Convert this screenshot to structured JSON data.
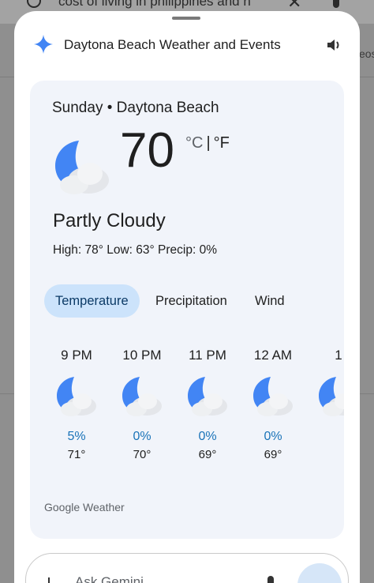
{
  "background": {
    "search_query": "cost of living in philippines and n",
    "right_snippet": "eos"
  },
  "header": {
    "title": "Daytona Beach Weather and Events"
  },
  "weather": {
    "location_line": "Sunday • Daytona Beach",
    "temperature": "70",
    "unit_c": "°C",
    "unit_separator": "|",
    "unit_f": "°F",
    "condition": "Partly Cloudy",
    "details": "High: 78°  Low: 63°  Precip: 0%",
    "tabs": [
      {
        "label": "Temperature",
        "active": true
      },
      {
        "label": "Precipitation",
        "active": false
      },
      {
        "label": "Wind",
        "active": false
      }
    ],
    "hourly": [
      {
        "time": "9 PM",
        "precip": "5%",
        "temp": "71°",
        "icon": "partly-cloudy-night-icon"
      },
      {
        "time": "10 PM",
        "precip": "0%",
        "temp": "70°",
        "icon": "partly-cloudy-night-icon"
      },
      {
        "time": "11 PM",
        "precip": "0%",
        "temp": "69°",
        "icon": "partly-cloudy-night-icon"
      },
      {
        "time": "12 AM",
        "precip": "0%",
        "temp": "69°",
        "icon": "partly-cloudy-night-icon"
      },
      {
        "time": "1",
        "precip": "",
        "temp": "",
        "icon": "partly-cloudy-night-icon"
      }
    ],
    "source": "Google Weather"
  },
  "input": {
    "placeholder": "Ask Gemini"
  },
  "colors": {
    "accent_blue": "#4285f4",
    "tab_active_bg": "#cce3fb",
    "precip_blue": "#1a73b8",
    "card_bg": "#f1f4fa"
  }
}
